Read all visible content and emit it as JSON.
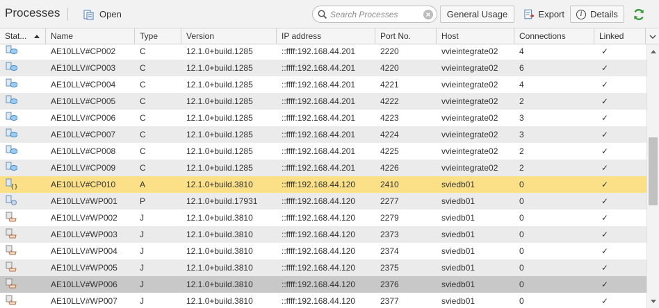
{
  "toolbar": {
    "title": "Processes",
    "open_label": "Open",
    "search_placeholder": "Search Processes",
    "general_usage_label": "General Usage",
    "export_label": "Export",
    "details_label": "Details",
    "details_icon_glyph": "i",
    "icons": {
      "open": "open-document-icon",
      "search": "search-icon",
      "clear": "clear-search-icon",
      "export": "export-icon",
      "details": "info-icon",
      "refresh": "refresh-icon"
    }
  },
  "table": {
    "columns": [
      "Stat...",
      "Name",
      "Type",
      "Version",
      "IP address",
      "Port No.",
      "Host",
      "Connections",
      "Linked"
    ],
    "sort_column": "Stat...",
    "sort_direction": "ascending",
    "rows": [
      {
        "status_icon": "cp-process-icon",
        "name": "AE10LLV#CP002",
        "type": "C",
        "version": "12.1.0+build.1285",
        "ip": "::ffff:192.168.44.201",
        "port": "2220",
        "host": "vvieintegrate02",
        "connections": "4",
        "linked": "✓",
        "state": "normal"
      },
      {
        "status_icon": "cp-process-icon",
        "name": "AE10LLV#CP003",
        "type": "C",
        "version": "12.1.0+build.1285",
        "ip": "::ffff:192.168.44.201",
        "port": "4220",
        "host": "vvieintegrate02",
        "connections": "6",
        "linked": "✓",
        "state": "alt"
      },
      {
        "status_icon": "cp-process-icon",
        "name": "AE10LLV#CP004",
        "type": "C",
        "version": "12.1.0+build.1285",
        "ip": "::ffff:192.168.44.201",
        "port": "4221",
        "host": "vvieintegrate02",
        "connections": "4",
        "linked": "✓",
        "state": "normal"
      },
      {
        "status_icon": "cp-process-icon",
        "name": "AE10LLV#CP005",
        "type": "C",
        "version": "12.1.0+build.1285",
        "ip": "::ffff:192.168.44.201",
        "port": "4222",
        "host": "vvieintegrate02",
        "connections": "2",
        "linked": "✓",
        "state": "alt"
      },
      {
        "status_icon": "cp-process-icon",
        "name": "AE10LLV#CP006",
        "type": "C",
        "version": "12.1.0+build.1285",
        "ip": "::ffff:192.168.44.201",
        "port": "4223",
        "host": "vvieintegrate02",
        "connections": "3",
        "linked": "✓",
        "state": "normal"
      },
      {
        "status_icon": "cp-process-icon",
        "name": "AE10LLV#CP007",
        "type": "C",
        "version": "12.1.0+build.1285",
        "ip": "::ffff:192.168.44.201",
        "port": "4224",
        "host": "vvieintegrate02",
        "connections": "3",
        "linked": "✓",
        "state": "alt"
      },
      {
        "status_icon": "cp-process-icon",
        "name": "AE10LLV#CP008",
        "type": "C",
        "version": "12.1.0+build.1285",
        "ip": "::ffff:192.168.44.201",
        "port": "4225",
        "host": "vvieintegrate02",
        "connections": "2",
        "linked": "✓",
        "state": "normal"
      },
      {
        "status_icon": "cp-process-icon",
        "name": "AE10LLV#CP009",
        "type": "C",
        "version": "12.1.0+build.1285",
        "ip": "::ffff:192.168.44.201",
        "port": "4226",
        "host": "vvieintegrate02",
        "connections": "2",
        "linked": "✓",
        "state": "alt"
      },
      {
        "status_icon": "rest-process-icon",
        "name": "AE10LLV#CP010",
        "type": "A",
        "version": "12.1.0+build.3810",
        "ip": "::ffff:192.168.44.120",
        "port": "2410",
        "host": "sviedb01",
        "connections": "0",
        "linked": "✓",
        "state": "highlight"
      },
      {
        "status_icon": "primary-wp-icon",
        "name": "AE10LLV#WP001",
        "type": "P",
        "version": "12.1.0+build.17931",
        "ip": "::ffff:192.168.44.120",
        "port": "2277",
        "host": "sviedb01",
        "connections": "0",
        "linked": "✓",
        "state": "alt"
      },
      {
        "status_icon": "java-wp-icon",
        "name": "AE10LLV#WP002",
        "type": "J",
        "version": "12.1.0+build.3810",
        "ip": "::ffff:192.168.44.120",
        "port": "2279",
        "host": "sviedb01",
        "connections": "0",
        "linked": "✓",
        "state": "normal"
      },
      {
        "status_icon": "java-wp-icon",
        "name": "AE10LLV#WP003",
        "type": "J",
        "version": "12.1.0+build.3810",
        "ip": "::ffff:192.168.44.120",
        "port": "2373",
        "host": "sviedb01",
        "connections": "0",
        "linked": "✓",
        "state": "alt"
      },
      {
        "status_icon": "java-wp-icon",
        "name": "AE10LLV#WP004",
        "type": "J",
        "version": "12.1.0+build.3810",
        "ip": "::ffff:192.168.44.120",
        "port": "2374",
        "host": "sviedb01",
        "connections": "0",
        "linked": "✓",
        "state": "normal"
      },
      {
        "status_icon": "java-wp-icon",
        "name": "AE10LLV#WP005",
        "type": "J",
        "version": "12.1.0+build.3810",
        "ip": "::ffff:192.168.44.120",
        "port": "2375",
        "host": "sviedb01",
        "connections": "0",
        "linked": "✓",
        "state": "alt"
      },
      {
        "status_icon": "java-wp-icon",
        "name": "AE10LLV#WP006",
        "type": "J",
        "version": "12.1.0+build.3810",
        "ip": "::ffff:192.168.44.120",
        "port": "2376",
        "host": "sviedb01",
        "connections": "0",
        "linked": "✓",
        "state": "selected"
      },
      {
        "status_icon": "java-wp-icon",
        "name": "AE10LLV#WP007",
        "type": "J",
        "version": "12.1.0+build.3810",
        "ip": "::ffff:192.168.44.120",
        "port": "2377",
        "host": "sviedb01",
        "connections": "0",
        "linked": "✓",
        "state": "normal"
      }
    ]
  },
  "colors": {
    "highlight_row": "#fbe087",
    "selected_row": "#c8c8c8",
    "alt_row": "#ebebeb",
    "refresh_icon": "#3a9a3a"
  }
}
